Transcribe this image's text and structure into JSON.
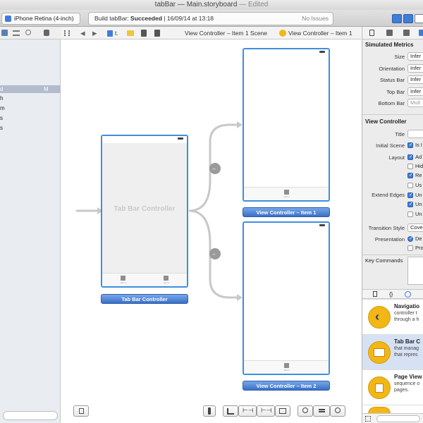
{
  "window": {
    "title_project": "tabBar",
    "title_sep": "—",
    "title_file": "Main.storyboard",
    "title_state": "— Edited"
  },
  "toolbar": {
    "scheme_device": "iPhone Retina (4-inch)",
    "status_prefix": "Build tabBar: ",
    "status_result": "Succeeded",
    "status_time": "| 16/09/14 at 13:18",
    "issues": "No Issues"
  },
  "navigator": {
    "items": [
      {
        "label": "d",
        "badge": "M",
        "selected": true
      },
      {
        "label": "h",
        "selected": false
      },
      {
        "label": "m",
        "selected": false
      },
      {
        "label": "s",
        "selected": false
      },
      {
        "label": "s",
        "selected": false
      }
    ]
  },
  "jumpbar": {
    "crumbs": [
      "t.",
      "View Controller – Item 1 Scene",
      "View Controller – Item 1"
    ]
  },
  "canvas": {
    "tab_bar_controller": {
      "watermark": "Tab Bar Controller",
      "label": "Tab Bar Controller",
      "tab_labels": [
        "Item 1",
        "Item 2"
      ]
    },
    "vc1": {
      "label": "View Controller – Item 1",
      "tab_label": "Item 1"
    },
    "vc2": {
      "label": "View Controller – Item 2",
      "tab_label": "Item 2"
    }
  },
  "inspector": {
    "simulated_metrics": {
      "heading": "Simulated Metrics",
      "rows": [
        {
          "label": "Size",
          "value": "Infer"
        },
        {
          "label": "Orientation",
          "value": "Infer"
        },
        {
          "label": "Status Bar",
          "value": "Infer"
        },
        {
          "label": "Top Bar",
          "value": "Infer"
        },
        {
          "label": "Bottom Bar",
          "value": "Mult"
        }
      ]
    },
    "view_controller": {
      "heading": "View Controller",
      "title_label": "Title",
      "title_value": "",
      "initial_scene_label": "Initial Scene",
      "initial_scene_option": "Is I",
      "layout_label": "Layout",
      "layout_options": [
        {
          "label": "Ad",
          "checked": true
        },
        {
          "label": "Hid",
          "checked": false
        },
        {
          "label": "Re",
          "checked": true
        },
        {
          "label": "Us",
          "checked": false
        }
      ],
      "extend_edges_label": "Extend Edges",
      "extend_options": [
        {
          "label": "Un",
          "checked": true
        },
        {
          "label": "Un",
          "checked": true
        },
        {
          "label": "Un",
          "checked": false
        }
      ],
      "transition_label": "Transition Style",
      "transition_value": "Cove",
      "presentation_label": "Presentation",
      "presentation_options": [
        "De",
        "Pro"
      ],
      "key_commands_label": "Key Commands"
    },
    "library": {
      "items": [
        {
          "title": "Navigatio",
          "desc1": "controller t",
          "desc2": "through a h",
          "selected": false
        },
        {
          "title": "Tab Bar C",
          "desc1": "that manag",
          "desc2": "that repres",
          "selected": true
        },
        {
          "title": "Page View",
          "desc1": "sequence o",
          "desc2": "pages.",
          "selected": false
        }
      ]
    }
  }
}
